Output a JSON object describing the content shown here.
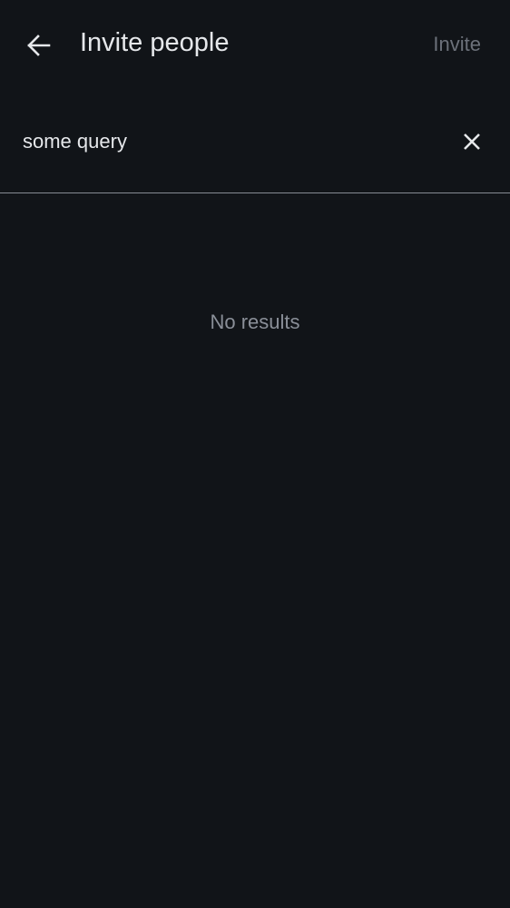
{
  "header": {
    "title": "Invite people",
    "invite_label": "Invite",
    "back_icon": "arrow-left-icon"
  },
  "search": {
    "value": "some query",
    "clear_icon": "close-icon"
  },
  "results": {
    "empty_text": "No results"
  },
  "colors": {
    "background": "#111418",
    "text": "#e6e8eb",
    "disabled": "#6c717a",
    "muted": "#8a8f98"
  }
}
